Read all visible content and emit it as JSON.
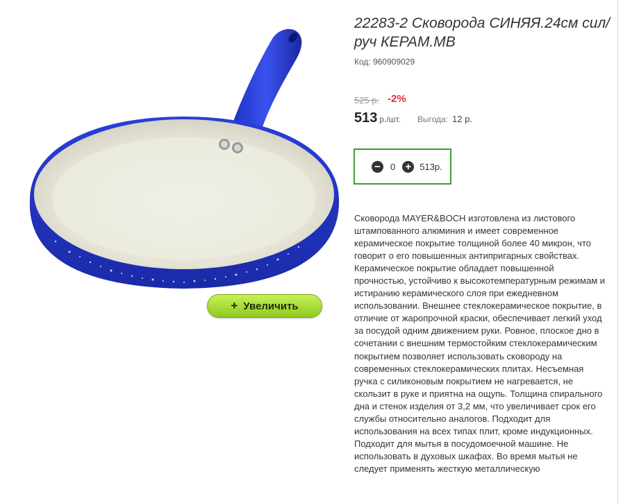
{
  "product": {
    "title": "22283-2 Сковорода СИНЯЯ.24см сил/руч КЕРАМ.МВ",
    "code": "Код: 960909029",
    "old_price": "525 р.",
    "discount": "-2%",
    "price": "513",
    "unit": "р./шт.",
    "profit_label": "Выгода:",
    "profit_value": "12 р.",
    "zoom_label": "Увеличить",
    "zoom_icon": "+",
    "quantity": "0",
    "total": "513р.",
    "minus_icon": "−",
    "plus_icon": "+",
    "description": "Сковорода MAYER&BOCH изготовлена из листового штампованного алюминия и имеет современное керамическое покрытие толщиной более 40 микрон, что говорит о его повышенных антипригарных свойствах. Керамическое покрытие обладает повышенной прочностью, устойчиво к высокотемпературным режимам и истиранию керамического слоя при ежедневном использовании. Внешнее стеклокерамическое покрытие, в отличие от жаропрочной краски, обеспечивает легкий уход за посудой одним движением руки. Ровное, плоское дно в сочетании с внешним термостойким стеклокерамическим покрытием позволяет использовать сковороду на современных стеклокерамических плитах. Несъемная ручка с силиконовым покрытием не нагревается, не скользит в руке и приятна на ощупь. Толщина спирального дна и стенок изделия от 3,2 мм, что увеличивает срок его службы относительно аналогов. Подходит для использования на всех типах плит, кроме индукционных. Подходит для мытья в посудомоечной машине. Не использовать в духовых шкафах. Во время мытья не следует применять жесткую металлическую"
  },
  "colors": {
    "accent_green": "#3c9c35",
    "discount_red": "#e32b46",
    "button_green": "#a6dc3a",
    "pan_blue": "#2a3fd6",
    "pan_ceramic": "#ecebe0"
  }
}
